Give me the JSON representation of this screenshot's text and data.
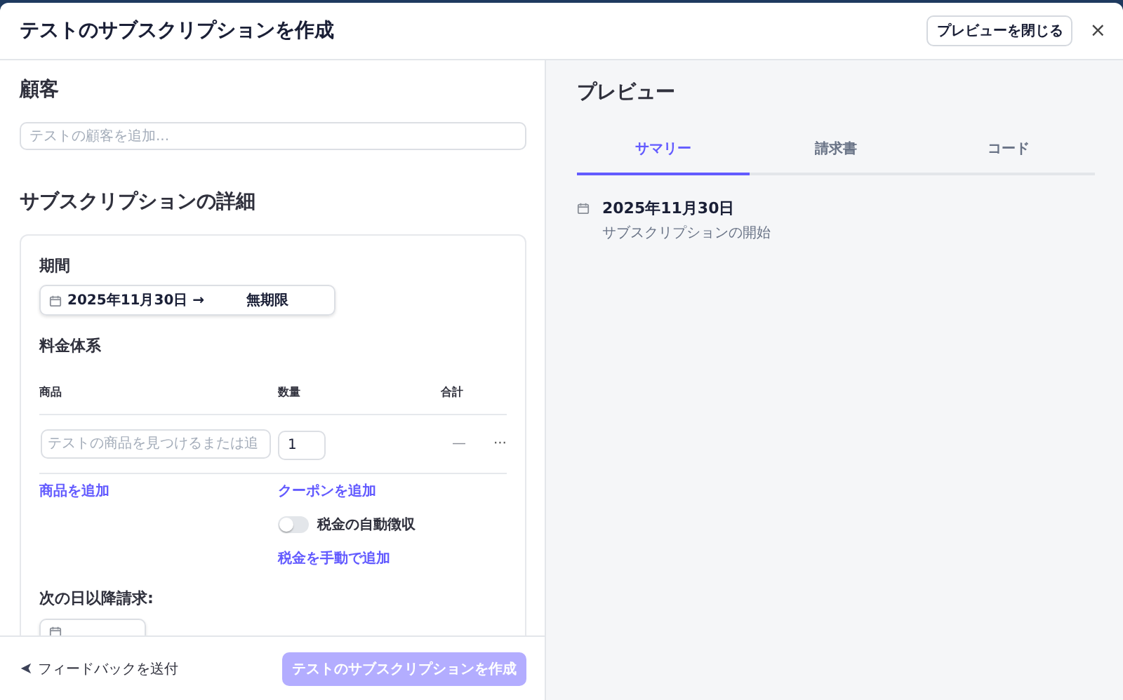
{
  "window": {
    "title": "テストのサブスクリプションを作成",
    "close_preview_button": "プレビューを閉じる",
    "close_button": "×"
  },
  "customer": {
    "heading": "顧客",
    "placeholder": "テストの顧客を追加..."
  },
  "details": {
    "heading": "サブスクリプションの詳細",
    "duration": {
      "label": "期間",
      "start": "2025年11月30日 →",
      "end": "無期限"
    },
    "pricing": {
      "label": "料金体系",
      "columns": [
        "商品",
        "数量",
        "合計"
      ],
      "rows": [
        {
          "product_placeholder": "テストの商品を見つけるまたは追",
          "quantity": "1",
          "total": "—",
          "more": "···"
        }
      ],
      "add_product_link": "商品を追加",
      "add_coupon_link": "クーポンを追加",
      "auto_tax": {
        "label": "税金の自動徴収",
        "on": false
      },
      "manual_tax_link": "税金を手動で追加"
    },
    "billing": {
      "label": "次の日以降請求:"
    }
  },
  "footer": {
    "feedback_link": "フィードバックを送付",
    "submit_button": {
      "label": "テストのサブスクリプションを作成",
      "disabled": true
    }
  },
  "preview": {
    "heading": "プレビュー",
    "tabs": [
      {
        "label": "サマリー",
        "selected": true
      },
      {
        "label": "請求書",
        "selected": false
      },
      {
        "label": "コード",
        "selected": false
      }
    ],
    "events": [
      {
        "date": "2025年11月30日",
        "description": "サブスクリプションの開始"
      }
    ]
  }
}
